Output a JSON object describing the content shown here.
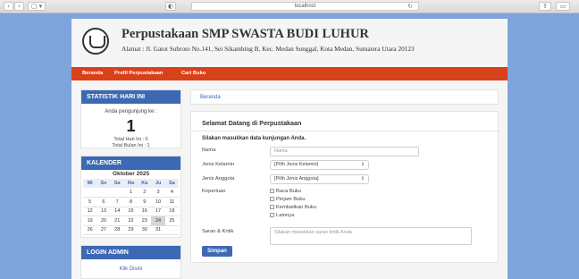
{
  "browser": {
    "url": "localhost",
    "back": "‹",
    "forward": "›",
    "sidebar_btn": "▢ ▾",
    "shield": "◐",
    "reload": "↻",
    "share": "⇪",
    "tabs": "▭"
  },
  "header": {
    "title": "Perpustakaan SMP SWASTA BUDI LUHUR",
    "address": "Alamat : Jl. Gatot Subroto No.141, Sei Sikambing B, Kec. Medan Sunggal, Kota Medan, Sumatera Utara 20123"
  },
  "nav": {
    "items": [
      "Beranda",
      "Profil Perpustakaan",
      "Cari Buku"
    ]
  },
  "statistik": {
    "heading": "STATISTIK HARI INI",
    "visitor_label": "Anda pengunjung ke :",
    "visitor_number": "1",
    "today": "Total Hari Ini : 0",
    "month": "Total Bulan Ini : 1"
  },
  "kalender": {
    "heading": "KALENDER",
    "month": "Oktober 2025",
    "days": [
      "Mi",
      "Se",
      "Sa",
      "Ra",
      "Ka",
      "Ju",
      "Sa"
    ],
    "weeks": [
      [
        "",
        "",
        "",
        "1",
        "2",
        "3",
        "4"
      ],
      [
        "5",
        "6",
        "7",
        "8",
        "9",
        "10",
        "11"
      ],
      [
        "12",
        "13",
        "14",
        "15",
        "16",
        "17",
        "18"
      ],
      [
        "19",
        "20",
        "21",
        "22",
        "23",
        "24",
        "25"
      ],
      [
        "26",
        "27",
        "28",
        "29",
        "30",
        "31",
        ""
      ]
    ],
    "highlight": "24"
  },
  "login": {
    "heading": "LOGIN ADMIN",
    "link": "Klik Disini"
  },
  "breadcrumb": "Beranda",
  "form": {
    "title": "Selamat Datang di Perpustakaan",
    "intro": "Silakan masukkan data kunjungan Anda.",
    "nama_label": "Nama",
    "nama_placeholder": "Nama",
    "jk_label": "Jenis Kelamin",
    "jk_value": "[Pilih Jenis Kelamin]",
    "ja_label": "Jenis Anggota",
    "ja_value": "[Pilih Jenis Anggota]",
    "keperluan_label": "Keperluan",
    "keperluan_options": [
      "Baca Buku",
      "Pinjam Buku",
      "Kembalikan Buku",
      "Lainnya"
    ],
    "saran_label": "Saran & Kritik",
    "saran_placeholder": "Silakan masukkan saran kritik Anda",
    "submit": "Simpan"
  },
  "colors": {
    "accent": "#3d69b4",
    "nav": "#d9411a",
    "page_bg": "#7ea4db"
  }
}
